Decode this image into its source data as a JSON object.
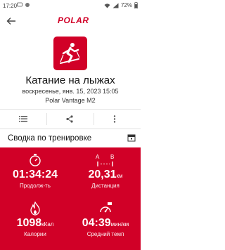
{
  "status_bar": {
    "time": "17:20",
    "battery": "72%"
  },
  "app": {
    "logo": "POLAR"
  },
  "workout": {
    "title": "Катание на лыжах",
    "datetime": "воскресенье, янв. 15, 2023 15:05",
    "device": "Polar Vantage M2"
  },
  "summary": {
    "title": "Сводка по тренировке"
  },
  "stats": {
    "duration": {
      "value": "01:34:24",
      "label": "Продолж-ть"
    },
    "distance": {
      "value": "20,31",
      "unit": "км",
      "label": "Дистанция",
      "icon_letters": [
        "A",
        "B"
      ]
    },
    "calories": {
      "value": "1098",
      "unit": "кКал",
      "label": "Калории"
    },
    "pace": {
      "value": "04:39",
      "unit": "мин/км",
      "label": "Средний темп"
    }
  },
  "colors": {
    "brand": "#d10027",
    "background": "#ffffff"
  },
  "icons": [
    "back-arrow-icon",
    "polar-logo",
    "skiing-icon",
    "list-icon",
    "share-icon",
    "more-vert-icon",
    "calendar-icon",
    "stopwatch-icon",
    "distance-icon",
    "flame-icon",
    "speedometer-icon"
  ]
}
